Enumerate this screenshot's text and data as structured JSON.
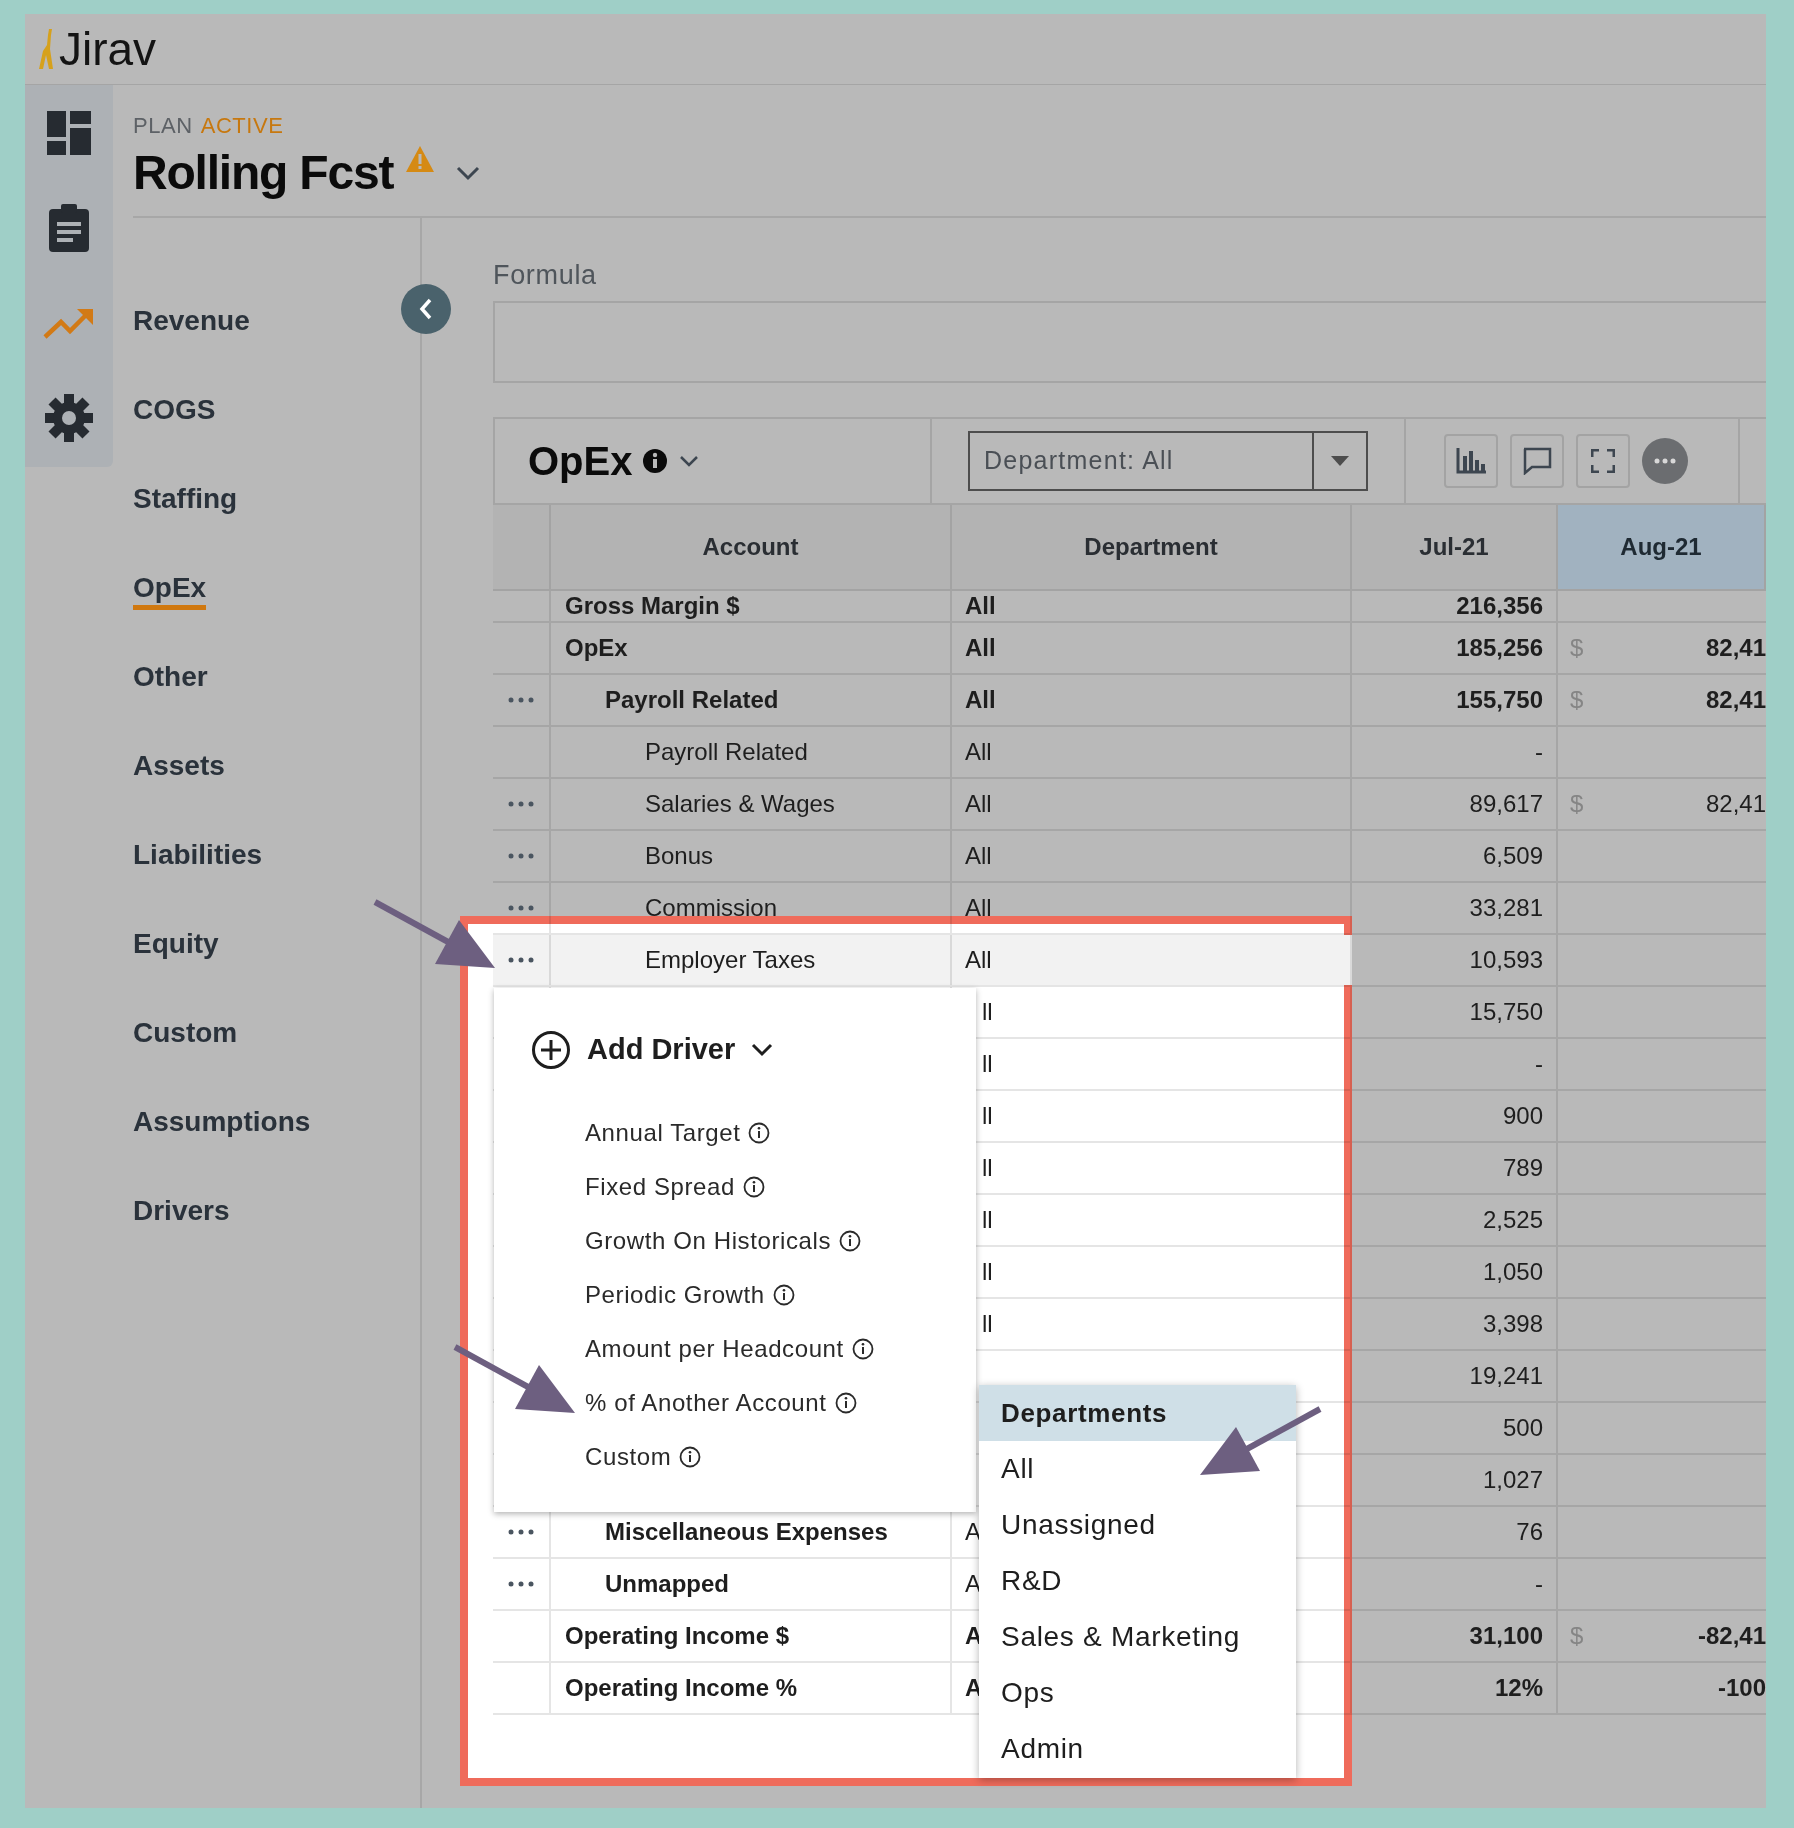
{
  "app": {
    "logo": "Jirav"
  },
  "rail": [
    {
      "kind": "dashboard",
      "selected": false
    },
    {
      "kind": "clipboard",
      "selected": false
    },
    {
      "kind": "trend",
      "selected": true
    },
    {
      "kind": "gear",
      "selected": false
    }
  ],
  "plan": {
    "label": "PLAN",
    "status": "ACTIVE",
    "title": "Rolling Fcst",
    "warning": true
  },
  "nav": [
    {
      "label": "Revenue",
      "selected": false
    },
    {
      "label": "COGS",
      "selected": false
    },
    {
      "label": "Staffing",
      "selected": false
    },
    {
      "label": "OpEx",
      "selected": true
    },
    {
      "label": "Other",
      "selected": false
    },
    {
      "label": "Assets",
      "selected": false
    },
    {
      "label": "Liabilities",
      "selected": false
    },
    {
      "label": "Equity",
      "selected": false
    },
    {
      "label": "Custom",
      "selected": false
    },
    {
      "label": "Assumptions",
      "selected": false
    },
    {
      "label": "Drivers",
      "selected": false
    }
  ],
  "formula": {
    "label": "Formula"
  },
  "section": {
    "title": "OpEx",
    "filter": "Department: All"
  },
  "toolbar": [
    {
      "kind": "chart"
    },
    {
      "kind": "comment"
    },
    {
      "kind": "fullscreen"
    },
    {
      "kind": "more"
    }
  ],
  "table": {
    "columns": [
      {
        "label": "Account",
        "selected": false
      },
      {
        "label": "Department",
        "selected": false
      },
      {
        "label": "Jul-21",
        "selected": false
      },
      {
        "label": "Aug-21",
        "selected": true
      }
    ],
    "rows": [
      {
        "account": "Gross Margin $",
        "department": "All",
        "jul": "216,356",
        "menu": false,
        "selected": false
      },
      {
        "account": "OpEx",
        "department": "All",
        "jul": "185,256",
        "aug_symbol": "$",
        "aug": "82,41",
        "menu": false,
        "selected": false,
        "children": [
          {
            "account": "Payroll Related",
            "department": "All",
            "jul": "155,750",
            "aug_symbol": "$",
            "aug": "82,41",
            "menu": true,
            "selected": false,
            "children": [
              {
                "account": "Payroll Related",
                "department": "All",
                "jul": "-",
                "menu": false,
                "selected": false
              },
              {
                "account": "Salaries & Wages",
                "department": "All",
                "jul": "89,617",
                "aug_symbol": "$",
                "aug": "82,41",
                "menu": true,
                "selected": false
              },
              {
                "account": "Bonus",
                "department": "All",
                "jul": "6,509",
                "menu": true,
                "selected": false
              },
              {
                "account": "Commission",
                "department": "All",
                "jul": "33,281",
                "menu": true,
                "selected": false
              },
              {
                "account": "Employer Taxes",
                "department": "All",
                "jul": "10,593",
                "menu": true,
                "selected": true
              },
              {
                "department": "ll",
                "jul": "15,750",
                "menu": false,
                "selected": false
              },
              {
                "department": "ll",
                "jul": "-",
                "menu": false,
                "selected": false
              },
              {
                "department": "ll",
                "jul": "900",
                "menu": false,
                "selected": false
              },
              {
                "department": "ll",
                "jul": "789",
                "menu": false,
                "selected": false
              },
              {
                "department": "ll",
                "jul": "2,525",
                "menu": false,
                "selected": false
              },
              {
                "department": "ll",
                "jul": "1,050",
                "menu": false,
                "selected": false
              },
              {
                "department": "ll",
                "jul": "3,398",
                "menu": false,
                "selected": false
              },
              {
                "jul": "19,241",
                "menu": false,
                "selected": false
              },
              {
                "jul": "500",
                "menu": false,
                "selected": false
              },
              {
                "jul": "1,027",
                "menu": false,
                "selected": false
              }
            ]
          },
          {
            "account": "Miscellaneous Expenses",
            "department": "A",
            "jul": "76",
            "menu": true,
            "selected": false
          },
          {
            "account": "Unmapped",
            "department": "A",
            "jul": "-",
            "menu": true,
            "selected": false
          }
        ]
      },
      {
        "account": "Operating Income $",
        "department": "A",
        "jul": "31,100",
        "aug_symbol": "$",
        "aug": "-82,41",
        "menu": false,
        "selected": false
      },
      {
        "account": "Operating Income %",
        "department": "A",
        "jul": "12%",
        "aug": "-100",
        "menu": false,
        "selected": false
      }
    ]
  },
  "driver_menu": {
    "title": "Add Driver",
    "items": [
      "Annual Target",
      "Fixed Spread",
      "Growth On Historicals",
      "Periodic Growth",
      "Amount per Headcount",
      "% of Another Account",
      "Custom"
    ]
  },
  "department_menu": {
    "title": "Departments",
    "options": [
      "All",
      "Unassigned",
      "R&D",
      "Sales & Marketing",
      "Ops",
      "Admin"
    ]
  }
}
